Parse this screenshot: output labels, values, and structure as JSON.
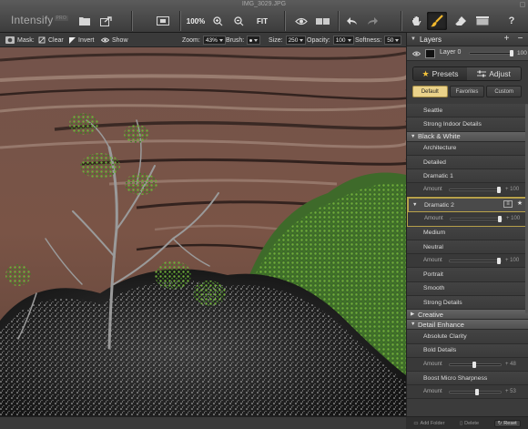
{
  "window": {
    "title": "IMG_3029.JPG"
  },
  "app": {
    "name": "Intensify",
    "badge": "PRO"
  },
  "toolbar": {
    "zoom_percent": "100%",
    "fit_label": "FIT"
  },
  "options": {
    "mask_label": "Mask:",
    "clear_label": "Clear",
    "invert_label": "Invert",
    "show_label": "Show",
    "zoom_label": "Zoom:",
    "zoom_value": "43%",
    "brush_label": "Brush:",
    "size_label": "Size:",
    "size_value": "250",
    "opacity_label": "Opacity:",
    "opacity_value": "100",
    "softness_label": "Softness:",
    "softness_value": "50"
  },
  "layers": {
    "title": "Layers",
    "add_label": "+",
    "remove_label": "−",
    "layer_name": "Layer 0",
    "layer_opacity_text": "100",
    "layer_opacity": 1.0
  },
  "tabs": {
    "presets": "Presets",
    "adjust": "Adjust",
    "active": "presets"
  },
  "subtabs": {
    "default": "Default",
    "favorites": "Favorites",
    "custom": "Custom",
    "active": "default"
  },
  "presets": {
    "top_items": [
      "Seattle",
      "Strong Indoor Details"
    ],
    "bw_title": "Black & White",
    "bw_items": [
      "Architecture",
      "Detailed",
      "Dramatic 1"
    ],
    "dramatic1_amount_label": "Amount",
    "dramatic1_amount_text": "100",
    "dramatic1_amount": 1.0,
    "selected_item": "Dramatic 2",
    "selected_amount_label": "Amount",
    "selected_amount_text": "100",
    "selected_amount": 1.0,
    "mid_items": [
      "Medium",
      "Neutral"
    ],
    "neutral_amount_label": "Amount",
    "neutral_amount_text": "100",
    "neutral_amount": 1.0,
    "end_items": [
      "Portrait",
      "Smooth",
      "Strong Details"
    ],
    "creative_title": "Creative",
    "detail_title": "Detail Enhance",
    "detail_items": [
      "Absolute Clarity",
      "Bold Details"
    ],
    "bold_amount_label": "Amount",
    "bold_amount_text": "48",
    "bold_amount": 0.48,
    "micro_item": "Boost Micro Sharpness",
    "micro_amount_label": "Amount",
    "micro_amount_text": "53",
    "micro_amount": 0.53
  },
  "footer": {
    "add_folder": "Add Folder",
    "delete": "Delete",
    "reset": "Reset"
  },
  "colors": {
    "accent": "#ead28a",
    "star": "#f3c23b",
    "brush": "#f1b82d"
  }
}
